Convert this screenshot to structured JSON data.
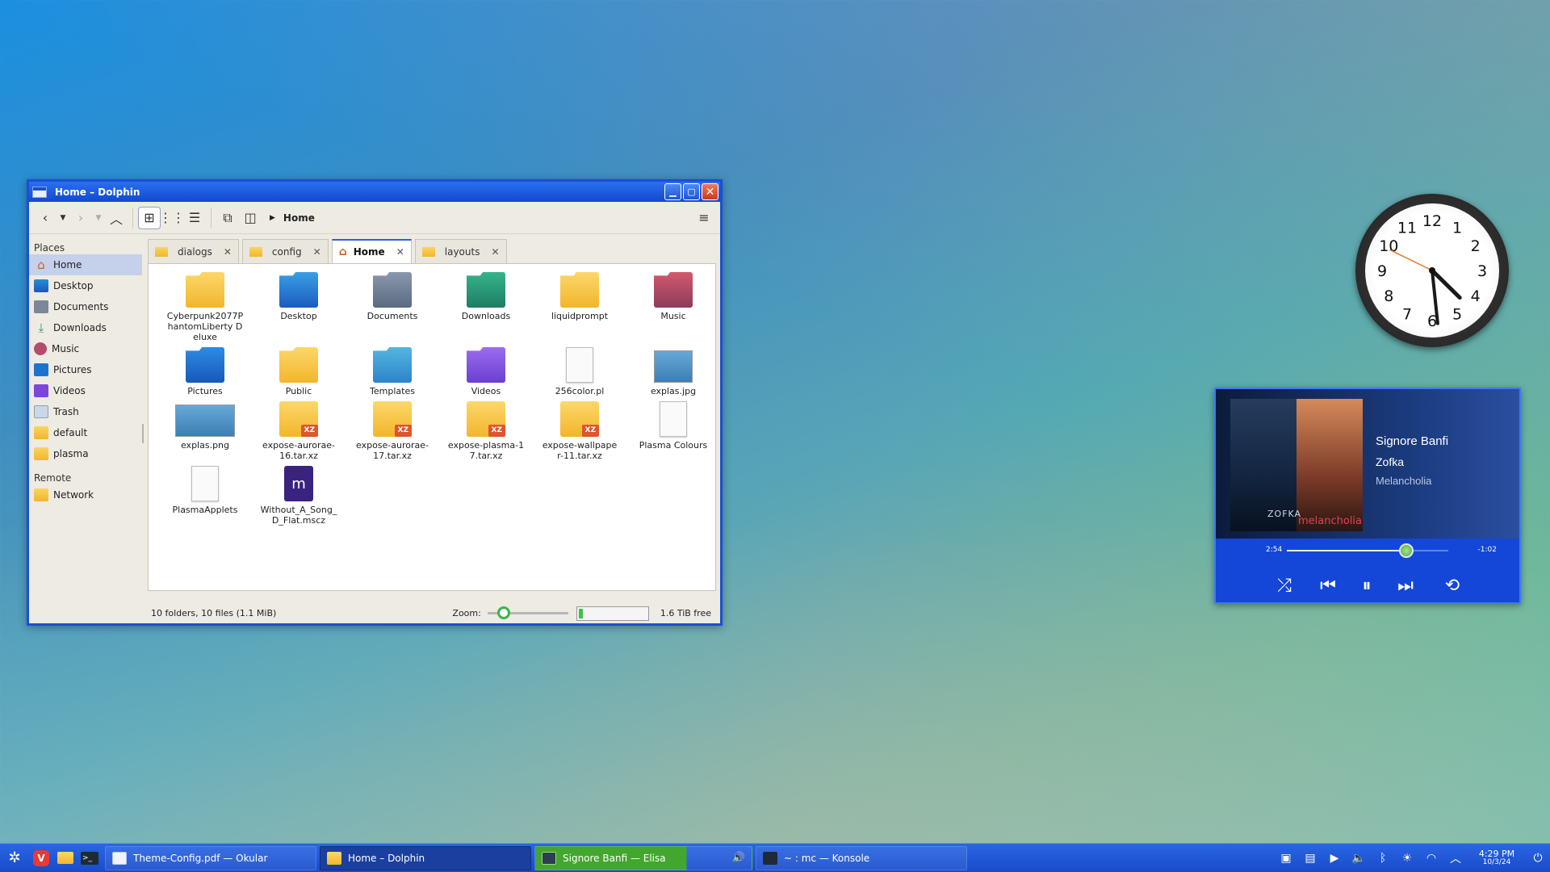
{
  "window": {
    "title": "Home – Dolphin",
    "breadcrumb": "Home",
    "places_header": "Places",
    "remote_header": "Remote",
    "places": [
      {
        "label": "Home",
        "icon": "home-icon"
      },
      {
        "label": "Desktop",
        "icon": "desktop-folder-icon"
      },
      {
        "label": "Documents",
        "icon": "documents-folder-icon"
      },
      {
        "label": "Downloads",
        "icon": "download-icon"
      },
      {
        "label": "Music",
        "icon": "music-icon"
      },
      {
        "label": "Pictures",
        "icon": "pictures-icon"
      },
      {
        "label": "Videos",
        "icon": "videos-icon"
      },
      {
        "label": "Trash",
        "icon": "trash-icon"
      },
      {
        "label": "default",
        "icon": "folder-icon"
      },
      {
        "label": "plasma",
        "icon": "folder-icon"
      }
    ],
    "remote": [
      {
        "label": "Network",
        "icon": "network-folder-icon"
      }
    ],
    "tabs": [
      {
        "label": "dialogs"
      },
      {
        "label": "config"
      },
      {
        "label": "Home"
      },
      {
        "label": "layouts"
      }
    ],
    "files": [
      {
        "name": "Cyberpunk2077PhantomLiberty Deluxe",
        "kind": "folder"
      },
      {
        "name": "Desktop",
        "kind": "folder-blue"
      },
      {
        "name": "Documents",
        "kind": "folder-gray"
      },
      {
        "name": "Downloads",
        "kind": "folder-teal"
      },
      {
        "name": "liquidprompt",
        "kind": "folder"
      },
      {
        "name": "Music",
        "kind": "folder-music"
      },
      {
        "name": "Pictures",
        "kind": "folder-pictures"
      },
      {
        "name": "Public",
        "kind": "folder-public"
      },
      {
        "name": "Templates",
        "kind": "folder-templates"
      },
      {
        "name": "Videos",
        "kind": "folder-videos"
      },
      {
        "name": "256color.pl",
        "kind": "doc"
      },
      {
        "name": "explas.jpg",
        "kind": "image"
      },
      {
        "name": "explas.png",
        "kind": "image-wide"
      },
      {
        "name": "expose-aurorae-16.tar.xz",
        "kind": "xz"
      },
      {
        "name": "expose-aurorae-17.tar.xz",
        "kind": "xz"
      },
      {
        "name": "expose-plasma-17.tar.xz",
        "kind": "xz"
      },
      {
        "name": "expose-wallpaper-11.tar.xz",
        "kind": "xz"
      },
      {
        "name": "Plasma Colours",
        "kind": "doc"
      },
      {
        "name": "PlasmaApplets",
        "kind": "doc"
      },
      {
        "name": "Without_A_Song_D_Flat.mscz",
        "kind": "mscz"
      }
    ],
    "xz_tag": "XZ",
    "status": "10 folders, 10 files (1.1 MiB)",
    "zoom_label": "Zoom:",
    "free_space": "1.6 TiB free",
    "disk_used_fraction": 0.06
  },
  "clock_widget": {
    "numerals": [
      "12",
      "1",
      "2",
      "3",
      "4",
      "5",
      "6",
      "7",
      "8",
      "9",
      "10",
      "11"
    ],
    "hour": 4,
    "minute": 29
  },
  "media_player": {
    "title": "Signore Banfi",
    "artist": "Zofka",
    "album": "Melancholia",
    "cover_caption_1": "ZOFKA",
    "cover_caption_2": "melancholia",
    "elapsed": "2:54",
    "remaining": "-1:02",
    "progress": 0.74
  },
  "taskbar": {
    "tasks": [
      {
        "label": "Theme-Config.pdf — Okular"
      },
      {
        "label": "Home – Dolphin"
      },
      {
        "label": "Signore Banfi — Elisa"
      },
      {
        "label": "~ : mc — Konsole"
      }
    ],
    "time": "4:29 PM",
    "date": "10/3/24",
    "colors": {
      "accent": "#1a4fd6",
      "elisa_green": "#43a62e"
    }
  }
}
